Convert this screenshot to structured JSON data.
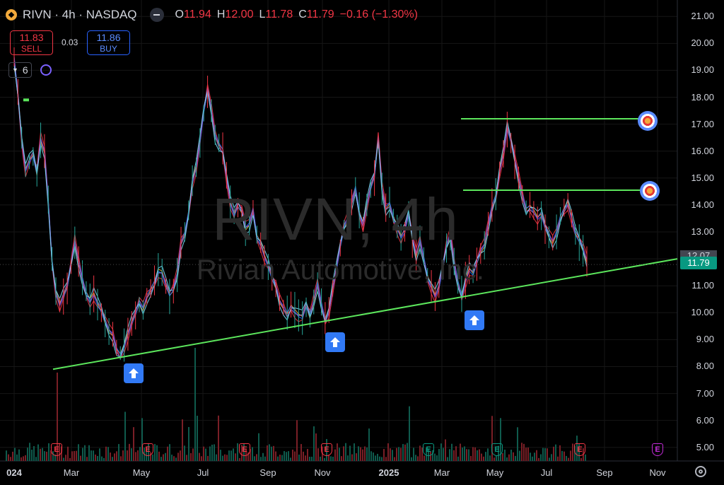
{
  "header": {
    "title": "RIVN · 4h · NASDAQ",
    "ohlc": {
      "o_label": "O",
      "o": "11.94",
      "h_label": "H",
      "h": "12.00",
      "l_label": "L",
      "l": "11.78",
      "c_label": "C",
      "c": "11.79",
      "change": "−0.16 (−1.30%)"
    }
  },
  "trade": {
    "sell_price": "11.83",
    "sell_label": "SELL",
    "spread": "0.03",
    "buy_price": "11.86",
    "buy_label": "BUY"
  },
  "indicators": {
    "count": "6"
  },
  "watermark": {
    "symbol": "RIVN, 4h",
    "name": "Rivian Automotive, Inc."
  },
  "price_axis": {
    "ticks": [
      "21.00",
      "20.00",
      "19.00",
      "18.00",
      "17.00",
      "16.00",
      "15.00",
      "14.00",
      "13.00",
      "12.00",
      "11.00",
      "10.00",
      "9.00",
      "8.00",
      "7.00",
      "6.00",
      "5.00"
    ],
    "last_price": "11.79",
    "prev_label": "12.07"
  },
  "time_axis": {
    "ticks": [
      {
        "label": "024",
        "bold": true
      },
      {
        "label": "Mar",
        "bold": false
      },
      {
        "label": "May",
        "bold": false
      },
      {
        "label": "Jul",
        "bold": false
      },
      {
        "label": "Sep",
        "bold": false
      },
      {
        "label": "Nov",
        "bold": false
      },
      {
        "label": "2025",
        "bold": true
      },
      {
        "label": "Mar",
        "bold": false
      },
      {
        "label": "May",
        "bold": false
      },
      {
        "label": "Jul",
        "bold": false
      },
      {
        "label": "Sep",
        "bold": false
      },
      {
        "label": "Nov",
        "bold": false
      }
    ]
  },
  "colors": {
    "up": "#089981",
    "down": "#f23645",
    "trendline": "#5ce65c",
    "background": "#000000",
    "accent": "#2962ff"
  },
  "earnings_markers": [
    {
      "label": "E",
      "status": "miss"
    },
    {
      "label": "E",
      "status": "miss"
    },
    {
      "label": "E",
      "status": "miss"
    },
    {
      "label": "E",
      "status": "miss"
    },
    {
      "label": "E",
      "status": "beat"
    },
    {
      "label": "E",
      "status": "beat"
    },
    {
      "label": "E",
      "status": "miss"
    },
    {
      "label": "E",
      "status": "upcoming"
    }
  ],
  "annotations": {
    "support_trendline": "ascending",
    "resistance_levels": [
      "17.20",
      "14.55"
    ],
    "buy_signals": [
      "arrow-up",
      "arrow-up",
      "arrow-up"
    ],
    "target_icons": [
      "target-icon",
      "target-icon"
    ]
  },
  "chart_data": {
    "type": "line",
    "symbol": "RIVN",
    "interval": "4h",
    "ylim": [
      4.6,
      21.4
    ],
    "series": [
      {
        "values": [
          19.5,
          18.2,
          16.5,
          15.3,
          15.6,
          15.8,
          15.1,
          16.4,
          16.0,
          14.2,
          12.0,
          10.8,
          10.3,
          10.6,
          10.9,
          11.7,
          12.6,
          11.9,
          11.3,
          10.8,
          10.5,
          10.7,
          10.3,
          10.0,
          9.6,
          9.3,
          9.2,
          8.7,
          8.5,
          8.8,
          9.2,
          9.6,
          9.9,
          10.3,
          10.1,
          10.6,
          10.9,
          11.2,
          11.6,
          11.5,
          11.0,
          10.6,
          10.8,
          11.4,
          12.6,
          13.0,
          13.8,
          14.9,
          15.4,
          16.3,
          17.4,
          18.2,
          17.5,
          16.6,
          16.3,
          16.1,
          15.1,
          14.1,
          13.6,
          13.9,
          13.7,
          13.1,
          13.3,
          13.9,
          12.9,
          12.6,
          12.1,
          11.7,
          11.2,
          10.9,
          10.4,
          10.2,
          10.0,
          10.3,
          10.1,
          9.9,
          9.8,
          10.2,
          9.8,
          10.4,
          11.1,
          10.4,
          9.8,
          10.1,
          10.9,
          11.6,
          12.4,
          13.1,
          13.5,
          14.1,
          14.7,
          13.8,
          13.3,
          14.0,
          14.6,
          15.0,
          16.4,
          14.6,
          13.9,
          14.1,
          13.6,
          13.2,
          12.8,
          13.0,
          13.6,
          12.7,
          12.1,
          12.7,
          12.1,
          11.4,
          11.0,
          10.6,
          10.9,
          11.6,
          12.4,
          12.9,
          11.9,
          11.2,
          10.7,
          11.2,
          11.6,
          11.4,
          11.8,
          12.2,
          12.5,
          13.3,
          14.0,
          14.4,
          15.3,
          15.9,
          16.8,
          16.3,
          15.6,
          15.0,
          14.4,
          13.9,
          14.0,
          13.8,
          13.5,
          13.6,
          13.1,
          12.8,
          12.6,
          13.0,
          13.6,
          13.9,
          14.1,
          13.5,
          12.9,
          12.6,
          12.3,
          11.9
        ]
      }
    ]
  }
}
